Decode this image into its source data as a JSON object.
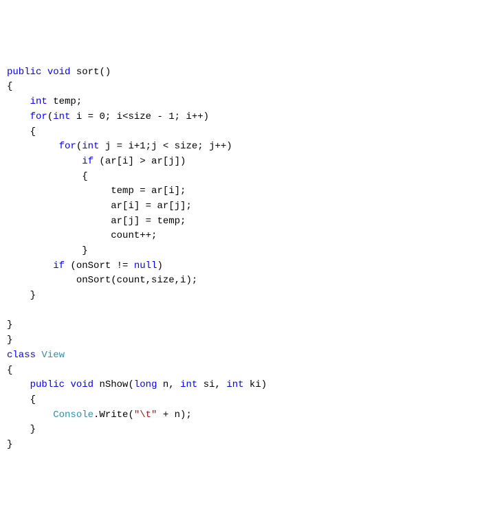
{
  "t": {
    "kw_public1": "public",
    "kw_void1": "void",
    "fn_sort": " sort()",
    "brace_o1": "{",
    "indent1": "    ",
    "kw_int1": "int",
    "temp_decl": " temp;",
    "kw_for1": "for",
    "for1_a": "(",
    "kw_int2": "int",
    "for1_b": " i = 0; i<size - 1; i++)",
    "brace_o2": "    {",
    "indent2": "         ",
    "kw_for2": "for",
    "for2_a": "(",
    "kw_int3": "int",
    "for2_b": " j = i+1;j < size; j++)",
    "indent3": "             ",
    "kw_if1": "if",
    "if1_cond": " (ar[i] > ar[j])",
    "brace_o3": "             {",
    "indent4": "                  ",
    "s1": "temp = ar[i];",
    "s2": "ar[i] = ar[j];",
    "s3": "ar[j] = temp;",
    "s4": "count++;",
    "brace_c3": "             }",
    "indent5": "        ",
    "kw_if2": "if",
    "if2_cond": " (onSort != ",
    "kw_null": "null",
    "if2_tail": ")",
    "indent6": "            ",
    "call_onsort": "onSort(count,size,i);",
    "brace_c2": "    }",
    "brace_c1a": "}",
    "brace_c1b": "}",
    "kw_class": "class",
    "sp": " ",
    "cls_view": "View",
    "brace_o4": "{",
    "kw_public2": "public",
    "kw_void2": "void",
    "fn_nshow_a": " nShow(",
    "kw_long": "long",
    "fn_nshow_b": " n, ",
    "kw_int4": "int",
    "fn_nshow_c": " si, ",
    "kw_int5": "int",
    "fn_nshow_d": " ki)",
    "brace_o5": "    {",
    "cls_console": "Console",
    "write_a": ".Write(",
    "str_lit": "\"\\t\"",
    "write_b": " + n);",
    "brace_c5": "    }",
    "brace_c4": "}"
  }
}
